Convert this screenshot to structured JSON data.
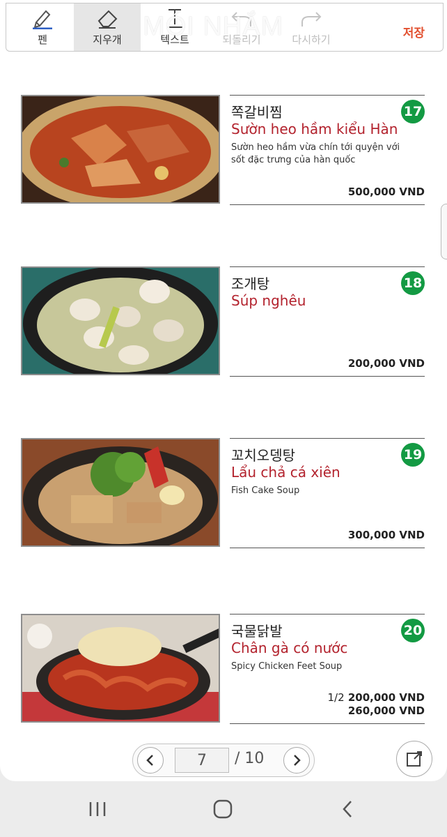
{
  "toolbar": {
    "pen": "펜",
    "eraser": "지우개",
    "text": "텍스트",
    "undo": "되돌리기",
    "redo": "다시하기",
    "save": "저장",
    "watermark": "MÓI NHẮM"
  },
  "items": [
    {
      "num": "17",
      "kr": "쪽갈비찜",
      "vn": "Sườn heo hầm kiểu Hàn",
      "desc": "Sườn heo hầm vừa chín tới quyện với sốt đặc trưng của hàn quốc",
      "price": "500,000 VND"
    },
    {
      "num": "18",
      "kr": "조개탕",
      "vn": "Súp nghêu",
      "desc": "",
      "price": "200,000 VND"
    },
    {
      "num": "19",
      "kr": "꼬치오뎅탕",
      "vn": "Lẩu chả cá xiên",
      "desc": "Fish Cake Soup",
      "price": "300,000 VND"
    },
    {
      "num": "20",
      "kr": "국물닭발",
      "vn": "Chân gà có nước",
      "desc": "Spicy Chicken Feet Soup",
      "price_half_label": "1/2",
      "price": "200,000 VND",
      "price2": "260,000 VND"
    }
  ],
  "pager": {
    "current": "7",
    "total": "/ 10"
  },
  "colors": {
    "accent": "#e2502f",
    "title_red": "#b3232e",
    "badge_green": "#139a43"
  }
}
